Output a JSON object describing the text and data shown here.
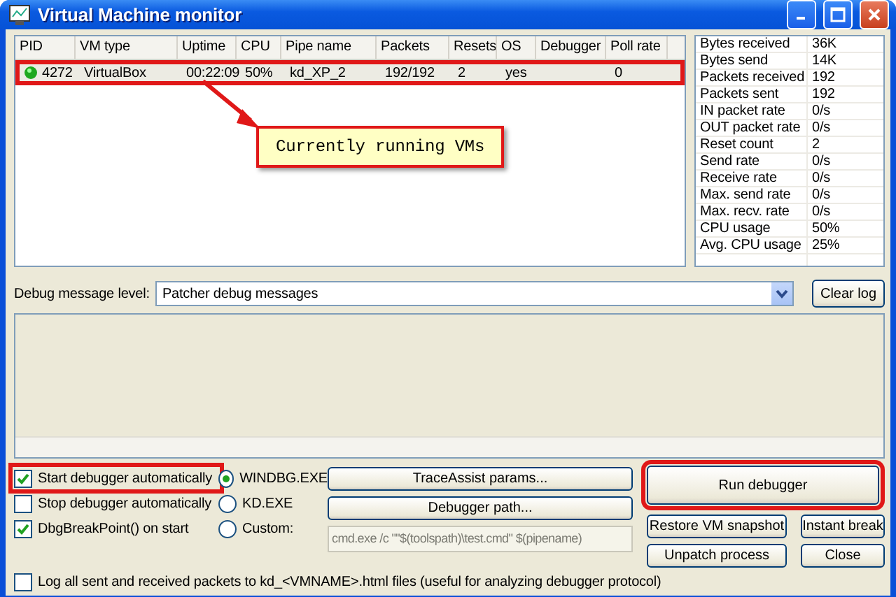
{
  "window": {
    "title": "Virtual Machine monitor"
  },
  "vm_table": {
    "columns": [
      "PID",
      "VM type",
      "Uptime",
      "CPU",
      "Pipe name",
      "Packets",
      "Resets",
      "OS",
      "Debugger",
      "Poll rate"
    ],
    "rows": [
      {
        "selected": true,
        "highlighted": true,
        "cells": [
          "4272",
          "VirtualBox",
          "00:22:09",
          "50%",
          "kd_XP_2",
          "192/192",
          "2",
          "yes",
          "",
          "0"
        ]
      }
    ]
  },
  "callout": "Currently running VMs",
  "stats": [
    {
      "name": "Bytes received",
      "value": "36K"
    },
    {
      "name": "Bytes send",
      "value": "14K"
    },
    {
      "name": "Packets received",
      "value": "192"
    },
    {
      "name": "Packets sent",
      "value": "192"
    },
    {
      "name": "IN packet rate",
      "value": "0/s"
    },
    {
      "name": "OUT packet rate",
      "value": "0/s"
    },
    {
      "name": "Reset count",
      "value": "2"
    },
    {
      "name": "Send rate",
      "value": "0/s"
    },
    {
      "name": "Receive rate",
      "value": "0/s"
    },
    {
      "name": "Max. send rate",
      "value": "0/s"
    },
    {
      "name": "Max. recv. rate",
      "value": "0/s"
    },
    {
      "name": "CPU usage",
      "value": "50%"
    },
    {
      "name": "Avg. CPU usage",
      "value": "25%"
    }
  ],
  "debug_level": {
    "label": "Debug message level:",
    "value": "Patcher debug messages"
  },
  "clear_log_button": "Clear log",
  "checkboxes": [
    {
      "label": "Start debugger automatically",
      "checked": true,
      "highlighted": true
    },
    {
      "label": "Stop debugger automatically",
      "checked": false,
      "highlighted": false
    },
    {
      "label": "DbgBreakPoint() on start",
      "checked": true,
      "highlighted": false
    }
  ],
  "debuggers": [
    {
      "label": "WINDBG.EXE",
      "selected": true
    },
    {
      "label": "KD.EXE",
      "selected": false
    },
    {
      "label": "Custom:",
      "selected": false
    }
  ],
  "custom_command": {
    "value": "cmd.exe /c \"\"$(toolspath)\\test.cmd\" $(pipename)",
    "disabled": true
  },
  "middle_buttons": [
    "TraceAssist params...",
    "Debugger path..."
  ],
  "run_button": {
    "label": "Run debugger",
    "highlighted": true
  },
  "action_buttons": [
    "Restore VM snapshot",
    "Instant break",
    "Unpatch process",
    "Close"
  ],
  "log_packets": {
    "label": "Log all sent and received packets to kd_<VMNAME>.html files (useful for analyzing debugger protocol)",
    "checked": false
  }
}
